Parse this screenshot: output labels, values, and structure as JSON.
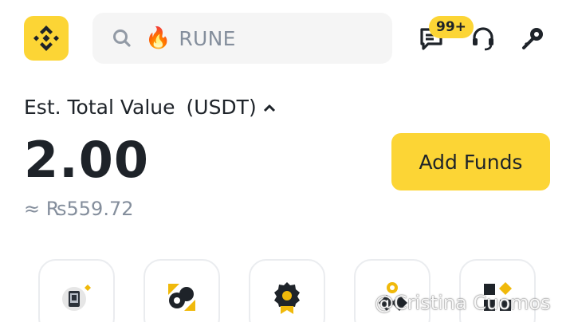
{
  "header": {
    "search": {
      "query": "RUNE",
      "icon": "search-icon",
      "trend_icon": "fire-icon"
    },
    "notifications_badge": "99+",
    "icons": [
      "messages-icon",
      "support-headset-icon",
      "sparkle-key-icon"
    ]
  },
  "balance": {
    "label": "Est. Total Value",
    "unit": "(USDT)",
    "value": "2.00",
    "approx": "≈ ₨559.72"
  },
  "actions": {
    "add_funds": "Add Funds"
  },
  "shortcuts": [
    "nft-icon",
    "launchpool-icon",
    "rewards-badge-icon",
    "p2p-icon",
    "more-icon"
  ],
  "watermark": "@Cristina Cuomos",
  "colors": {
    "accent": "#fcd535",
    "text": "#1e2329",
    "muted": "#848e9c"
  }
}
